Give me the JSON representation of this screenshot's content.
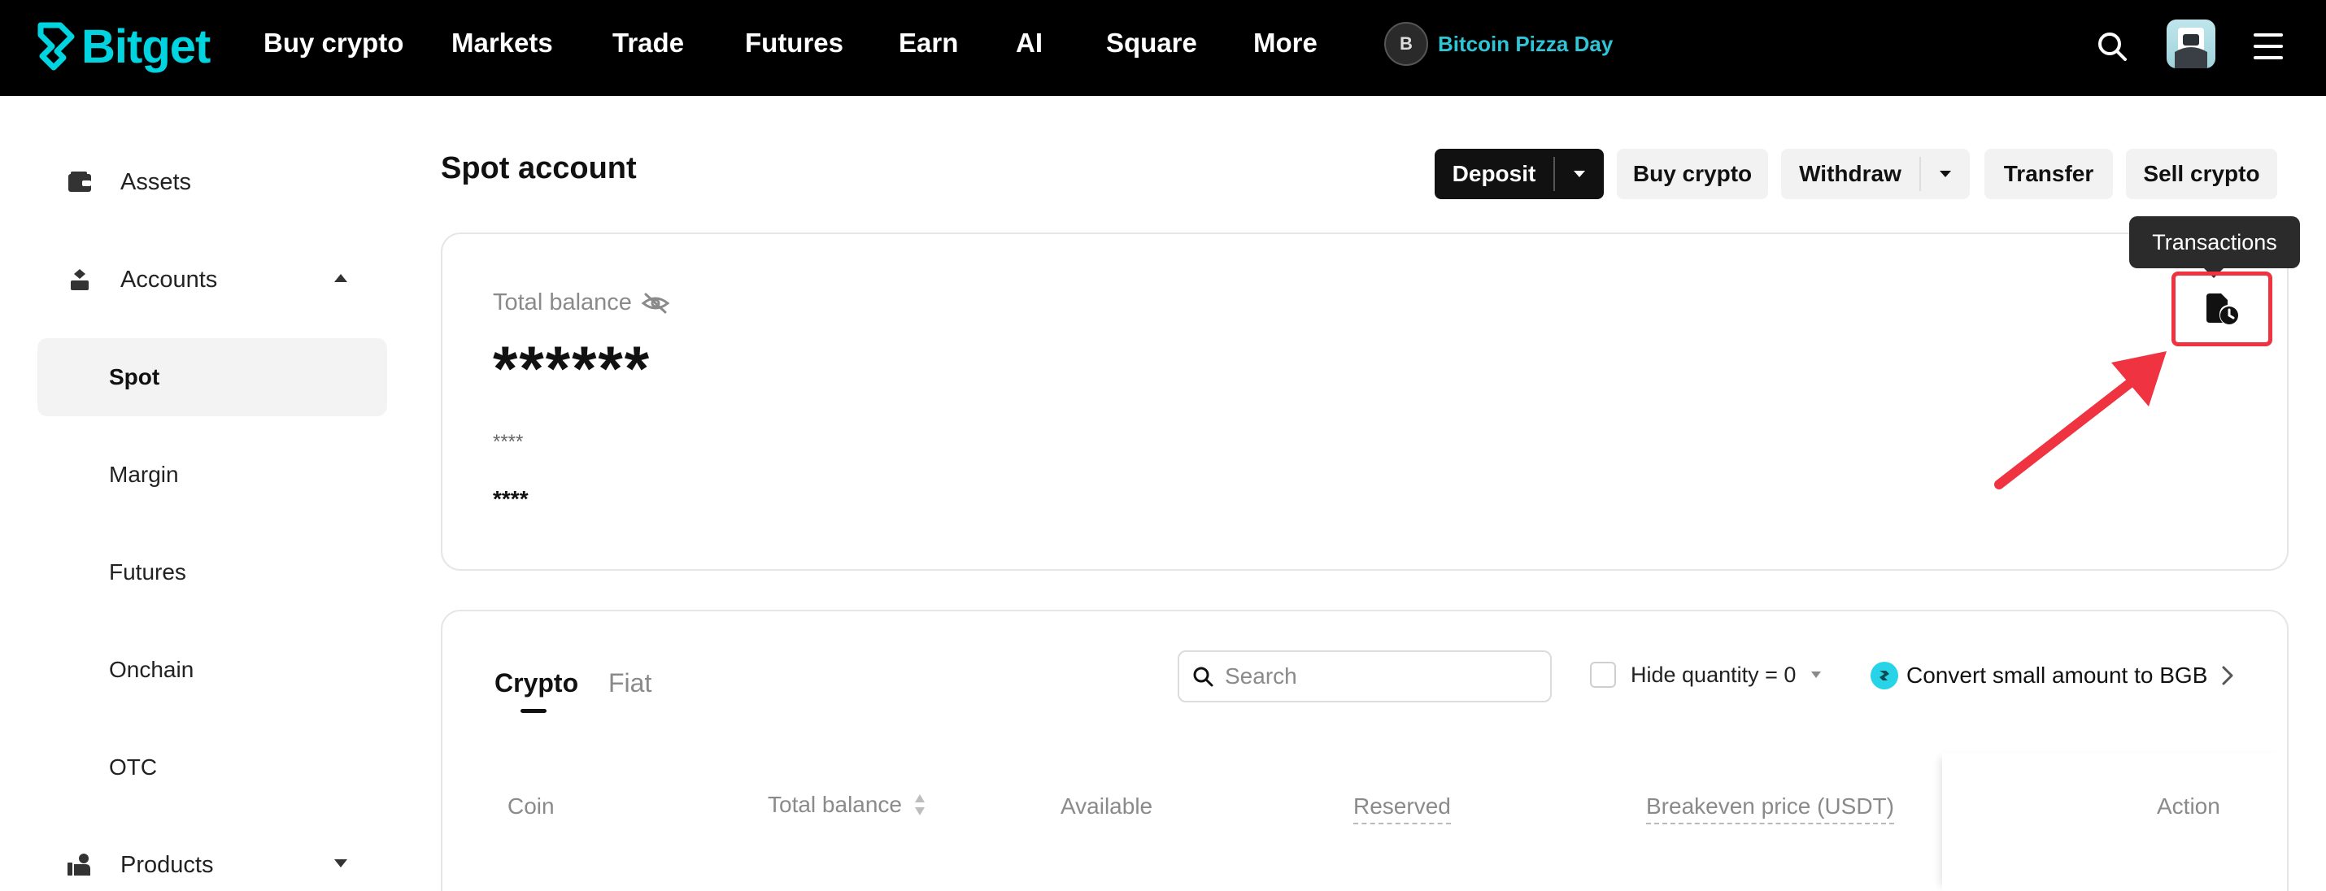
{
  "brand": {
    "name": "Bitget",
    "accent": "#00d4e0"
  },
  "nav": {
    "items": [
      "Buy crypto",
      "Markets",
      "Trade",
      "Futures",
      "Earn",
      "AI",
      "Square",
      "More"
    ],
    "promo_text": "Bitcoin Pizza Day",
    "promo_badge": "B"
  },
  "sidebar": {
    "assets": "Assets",
    "accounts": "Accounts",
    "sub_items": [
      "Spot",
      "Margin",
      "Futures",
      "Onchain",
      "OTC"
    ],
    "active": "Spot",
    "products": "Products"
  },
  "header": {
    "title": "Spot account",
    "deposit": "Deposit",
    "buy_crypto": "Buy crypto",
    "withdraw": "Withdraw",
    "transfer": "Transfer",
    "sell_crypto": "Sell crypto"
  },
  "tooltip": {
    "transactions": "Transactions"
  },
  "balance": {
    "label": "Total balance",
    "value": "******",
    "sub1": "****",
    "sub2": "****"
  },
  "assets_table": {
    "tabs": [
      "Crypto",
      "Fiat"
    ],
    "search_placeholder": "Search",
    "hide_zero": "Hide quantity = 0",
    "convert": "Convert small amount to BGB",
    "columns": [
      "Coin",
      "Total balance",
      "Available",
      "Reserved",
      "Breakeven price (USDT)",
      "Action"
    ]
  },
  "colors": {
    "highlight": "#ef3340",
    "tab_active": "#111111"
  }
}
